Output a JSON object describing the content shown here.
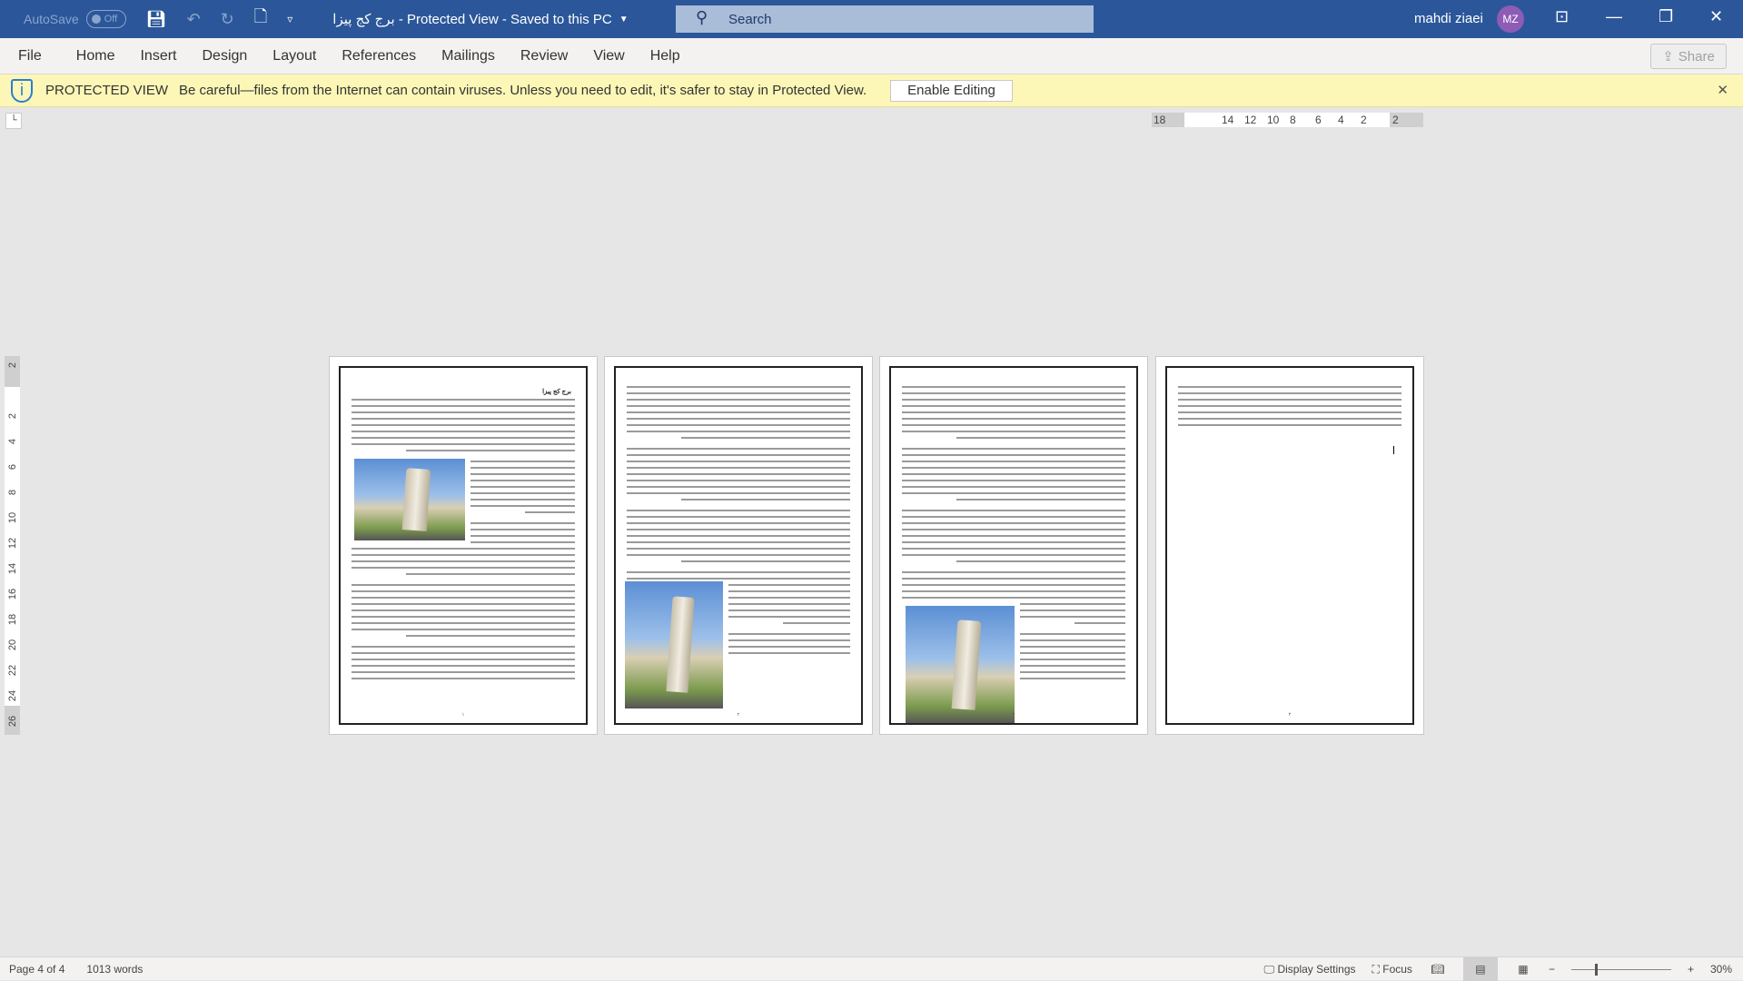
{
  "titlebar": {
    "autosave_label": "AutoSave",
    "autosave_state": "Off",
    "doc_title": "برج کج پیزا  -  Protected View  -  Saved to this PC",
    "search_placeholder": "Search",
    "user_name": "mahdi ziaei",
    "avatar_initials": "MZ"
  },
  "ribbon": {
    "tabs": [
      "File",
      "Home",
      "Insert",
      "Design",
      "Layout",
      "References",
      "Mailings",
      "Review",
      "View",
      "Help"
    ],
    "share_label": "Share"
  },
  "protected_view": {
    "title": "PROTECTED VIEW",
    "message": "Be careful—files from the Internet can contain viruses. Unless you need to edit, it's safer to stay in Protected View.",
    "button": "Enable Editing"
  },
  "ruler": {
    "horizontal": [
      "18",
      "14",
      "12",
      "10",
      "8",
      "6",
      "4",
      "2",
      "2"
    ],
    "vertical": [
      "2",
      "2",
      "4",
      "6",
      "8",
      "10",
      "12",
      "14",
      "16",
      "18",
      "20",
      "22",
      "24",
      "26"
    ]
  },
  "document": {
    "heading": "برج کج پیزا",
    "page_numbers": [
      "۱",
      "۲",
      "۳",
      "۴"
    ]
  },
  "status": {
    "page": "Page 4 of 4",
    "words": "1013 words",
    "display_settings": "Display Settings",
    "focus": "Focus",
    "zoom": "30%"
  },
  "colors": {
    "titlebar": "#2b579a",
    "protected_bar": "#fcf7b6",
    "avatar": "#8e5bb5"
  }
}
